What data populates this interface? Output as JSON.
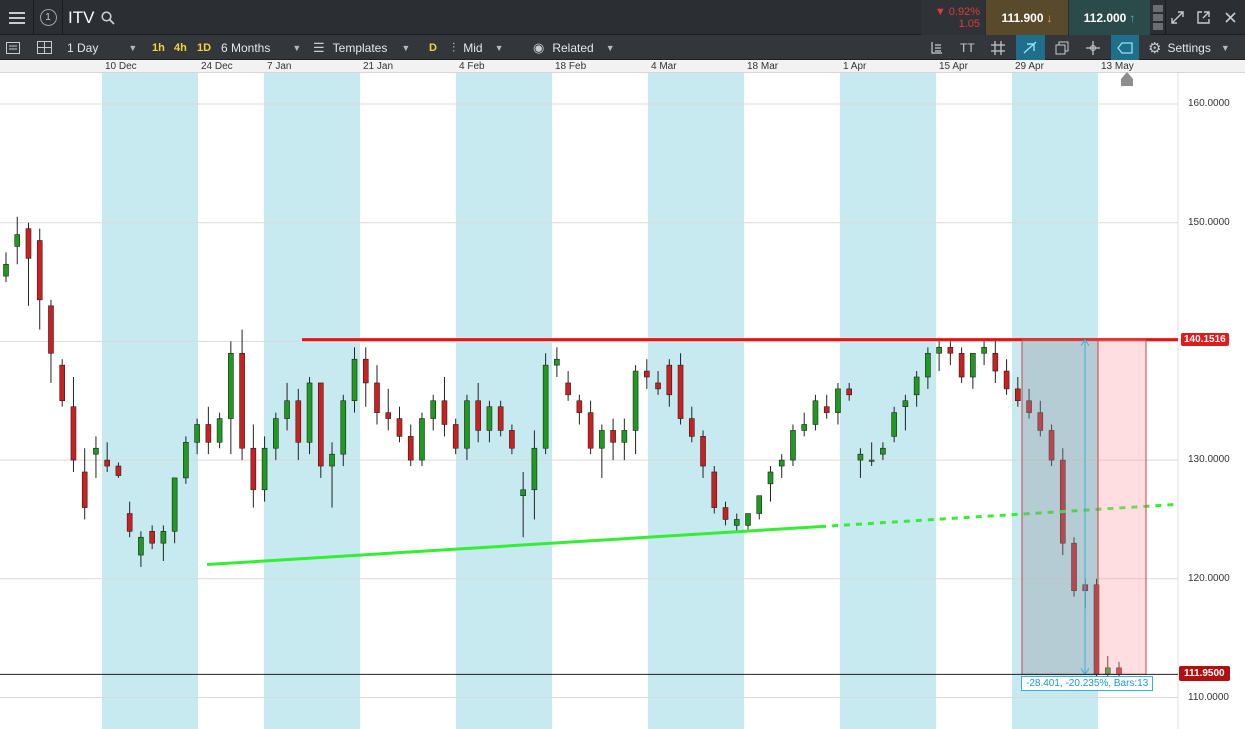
{
  "header": {
    "symbol": "ITV",
    "info_glyph": "1",
    "change_pct": "▼ 0.92%",
    "change_abs": "1.05",
    "sell_price": "111.900",
    "buy_price": "112.000",
    "colors": {
      "bar": "#2b2e33",
      "sell": "#5a4a2c",
      "buy": "#2b4a4a",
      "down": "#e03a3a"
    }
  },
  "toolbar": {
    "interval": "1 Day",
    "quick_1h": "1h",
    "quick_4h": "4h",
    "quick_1d": "1D",
    "range": "6 Months",
    "templates": "Templates",
    "draw_d": "D",
    "price_type": "Mid",
    "related": "Related",
    "settings": "Settings",
    "text_tool": "TT"
  },
  "chart_data": {
    "type": "candlestick",
    "x_ticks": [
      "10 Dec",
      "24 Dec",
      "7 Jan",
      "21 Jan",
      "4 Feb",
      "18 Feb",
      "4 Mar",
      "18 Mar",
      "1 Apr",
      "15 Apr",
      "29 Apr",
      "13 May"
    ],
    "y_ticks": [
      "110.0000",
      "120.0000",
      "130.0000",
      "140.0000",
      "150.0000",
      "160.0000"
    ],
    "ylim": [
      107.5,
      163.5
    ],
    "last_price_label": "111.9500",
    "last_price": 111.95,
    "resistance_label": "140.1516",
    "resistance": 140.15,
    "support_trendline": {
      "from": [
        "24 Dec",
        121.2
      ],
      "to": [
        "29 Mar",
        124.4
      ]
    },
    "measure_label": "-28.401, -20.235%, Bars:13",
    "colors": {
      "up": "#1e9a1e",
      "down": "#cc2020",
      "resistance": "#ee1111",
      "support": "#33ee33",
      "band": "#c6eaf0"
    },
    "candles": [
      [
        145.5,
        147.5,
        145.0,
        146.5
      ],
      [
        148.0,
        150.5,
        146.5,
        149.0
      ],
      [
        149.5,
        150.0,
        143.0,
        147.0
      ],
      [
        148.5,
        149.5,
        141.0,
        143.5
      ],
      [
        143.0,
        143.5,
        136.5,
        139.0
      ],
      [
        138.0,
        138.5,
        134.5,
        135.0
      ],
      [
        134.5,
        137.0,
        129.0,
        130.0
      ],
      [
        129.0,
        131.0,
        125.0,
        126.0
      ],
      [
        130.5,
        132.0,
        128.5,
        131.0
      ],
      [
        130.0,
        131.5,
        129.0,
        129.5
      ],
      [
        129.5,
        129.8,
        128.5,
        128.7
      ],
      [
        125.5,
        126.5,
        123.5,
        124.0
      ],
      [
        122.0,
        124.0,
        121.0,
        123.5
      ],
      [
        124.0,
        124.5,
        122.5,
        123.0
      ],
      [
        123.0,
        124.5,
        121.5,
        124.0
      ],
      [
        124.0,
        128.5,
        123.0,
        128.5
      ],
      [
        128.5,
        132.0,
        128.0,
        131.5
      ],
      [
        131.5,
        133.5,
        130.5,
        133.0
      ],
      [
        133.0,
        134.5,
        130.5,
        131.5
      ],
      [
        131.5,
        134.0,
        131.0,
        133.5
      ],
      [
        133.5,
        140.0,
        130.5,
        139.0
      ],
      [
        139.0,
        141.0,
        130.0,
        131.0
      ],
      [
        131.0,
        133.0,
        126.0,
        127.5
      ],
      [
        127.5,
        132.0,
        126.5,
        131.0
      ],
      [
        131.0,
        134.0,
        130.0,
        133.5
      ],
      [
        133.5,
        136.5,
        132.5,
        135.0
      ],
      [
        135.0,
        136.0,
        130.0,
        131.5
      ],
      [
        131.5,
        137.0,
        130.5,
        136.5
      ],
      [
        136.5,
        136.5,
        128.5,
        129.5
      ],
      [
        129.5,
        131.5,
        126.0,
        130.5
      ],
      [
        130.5,
        135.5,
        129.5,
        135.0
      ],
      [
        135.0,
        139.5,
        134.0,
        138.5
      ],
      [
        138.5,
        139.5,
        134.5,
        136.5
      ],
      [
        136.5,
        138.0,
        133.0,
        134.0
      ],
      [
        134.0,
        136.0,
        132.5,
        133.5
      ]
    ]
  }
}
